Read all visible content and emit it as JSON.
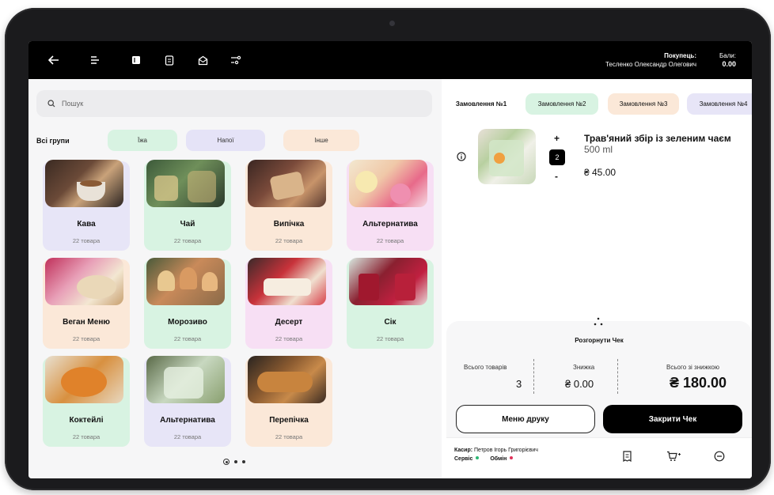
{
  "topbar": {
    "buyer_label": "Покупець:",
    "buyer_name": "Тесленко Олександр Олегович",
    "bonus_label": "Бали:",
    "bonus_value": "0.00"
  },
  "search": {
    "placeholder": "Пошук"
  },
  "groups": {
    "label": "Всі групи",
    "chips": [
      {
        "label": "Їжа",
        "color": "#d8f3e2"
      },
      {
        "label": "Напої",
        "color": "#e5e3f7"
      },
      {
        "label": "Інше",
        "color": "#fbe8d8"
      }
    ]
  },
  "categories": [
    {
      "name": "Кава",
      "count": "22 товара",
      "color": "#e7e5f7"
    },
    {
      "name": "Чай",
      "count": "22 товара",
      "color": "#d8f3e2"
    },
    {
      "name": "Випічка",
      "count": "22 товара",
      "color": "#fbe8d8"
    },
    {
      "name": "Альтернатива",
      "count": "22 товара",
      "color": "#f7dff4"
    },
    {
      "name": "Веган Меню",
      "count": "22 товара",
      "color": "#fbe8d8"
    },
    {
      "name": "Морозиво",
      "count": "22 товара",
      "color": "#d8f3e2"
    },
    {
      "name": "Десерт",
      "count": "22 товара",
      "color": "#f7dff4"
    },
    {
      "name": "Сік",
      "count": "22 товара",
      "color": "#d8f3e2"
    },
    {
      "name": "Коктейлі",
      "count": "22 товара",
      "color": "#d8f3e2"
    },
    {
      "name": "Альтернатива",
      "count": "22 товара",
      "color": "#e7e5f7"
    },
    {
      "name": "Перепічка",
      "count": "22 товара",
      "color": "#fbe8d8"
    }
  ],
  "orders": {
    "tabs": [
      {
        "label": "Замовлення №1",
        "color": "#ffffff"
      },
      {
        "label": "Замовлення №2",
        "color": "#d8f3e2"
      },
      {
        "label": "Замовлення №3",
        "color": "#fbe8d8"
      },
      {
        "label": "Замовлення №4",
        "color": "#e7e5f7"
      }
    ]
  },
  "order_item": {
    "name": "Трав'яний збір із зеленим чаєм",
    "volume": "500 ml",
    "price": "₴ 45.00",
    "quantity": "2",
    "plus": "+",
    "minus": "-"
  },
  "check": {
    "expand_label": "Розгорнути Чек",
    "total_items_label": "Всього товарів",
    "total_items_value": "3",
    "discount_label": "Знижка",
    "discount_value": "₴ 0.00",
    "total_label": "Всього зі знижкою",
    "total_value": "₴ 180.00",
    "print_menu_label": "Меню друку",
    "close_label": "Закрити Чек"
  },
  "footer": {
    "cashier_label": "Касир:",
    "cashier_name": "Петров Ігорь Григорієвич",
    "service_label": "Сервіс",
    "exchange_label": "Обмін",
    "service_color": "#2bb673",
    "exchange_color": "#e0325a"
  }
}
